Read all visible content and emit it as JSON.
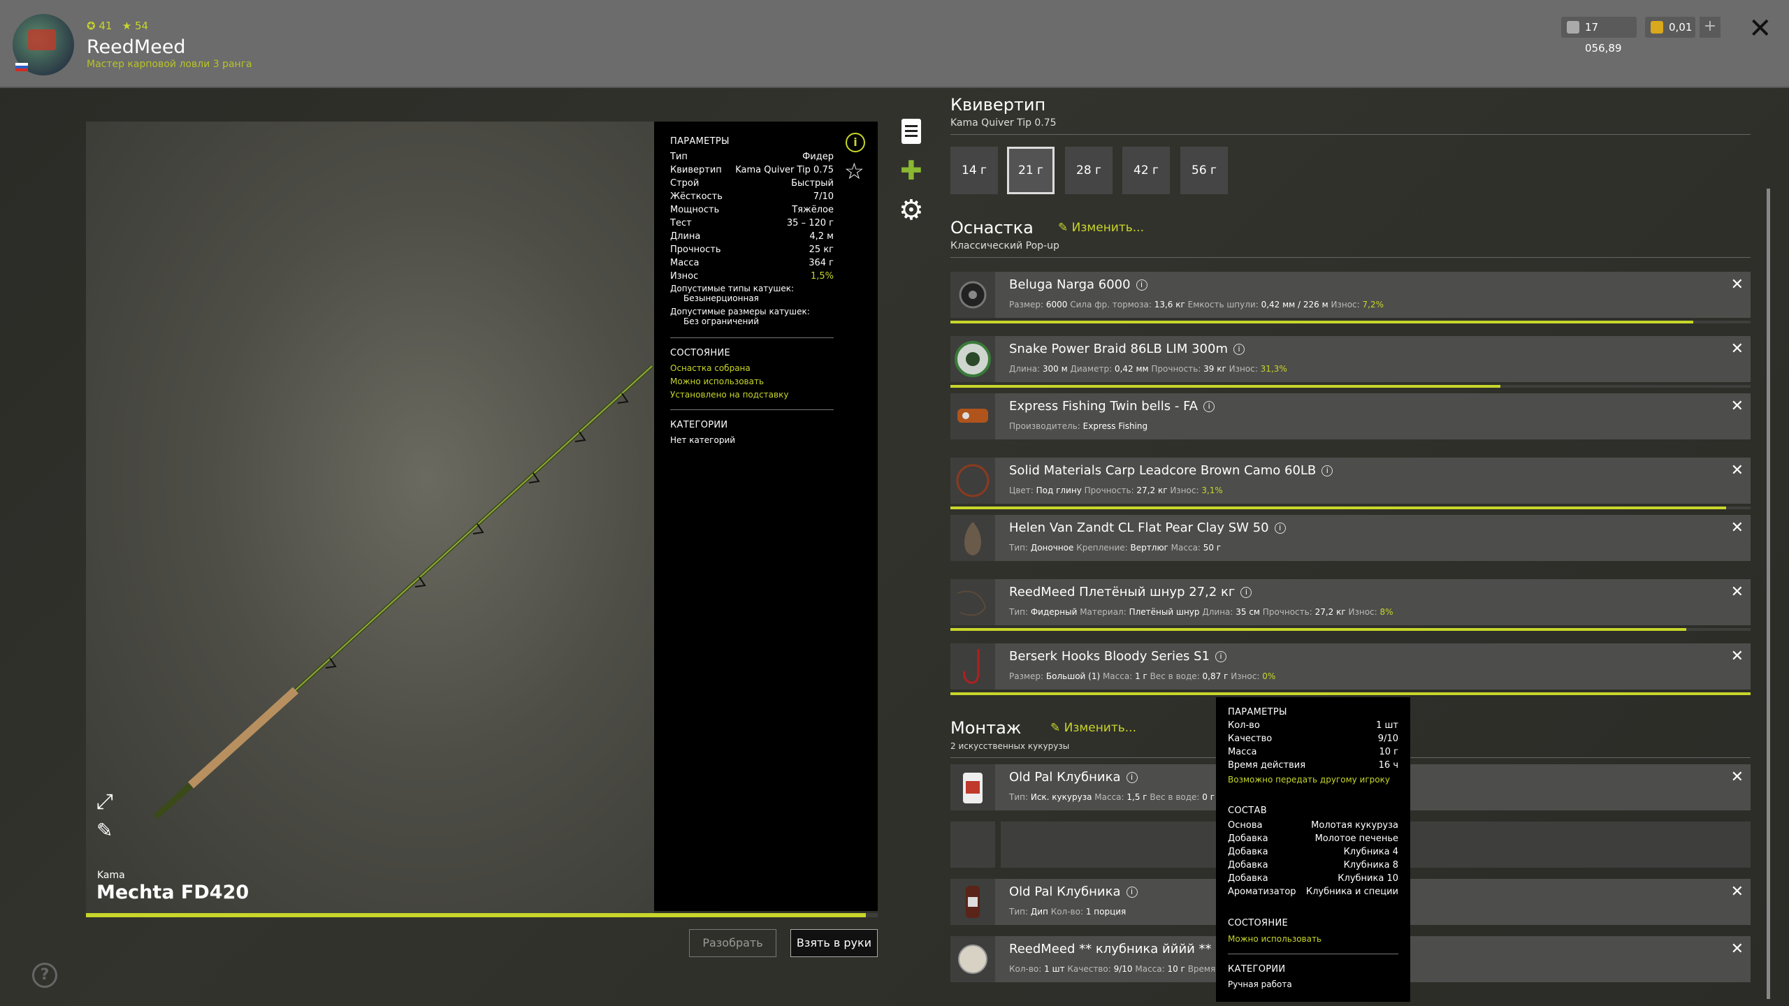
{
  "header": {
    "player_level": "41",
    "player_stars": "54",
    "username": "ReedMeed",
    "rank": "Мастер карповой ловли 3 ранга",
    "silver": "17 056,89",
    "gold": "0,01"
  },
  "rod": {
    "brand": "Kama",
    "name": "Mechta FD420",
    "btn_disassemble": "Разобрать",
    "btn_take": "Взять в руки"
  },
  "params": {
    "title": "ПАРАМЕТРЫ",
    "rows": [
      [
        "Тип",
        "Фидер"
      ],
      [
        "Квивертип",
        "Kama Quiver Tip 0.75"
      ],
      [
        "Строй",
        "Быстрый"
      ],
      [
        "Жёсткость",
        "7/10"
      ],
      [
        "Мощность",
        "Тяжёлое"
      ],
      [
        "Тест",
        "35 – 120 г"
      ],
      [
        "Длина",
        "4,2 м"
      ],
      [
        "Прочность",
        "25 кг"
      ],
      [
        "Масса",
        "364 г"
      ],
      [
        "Износ",
        "1,5%"
      ]
    ],
    "reel_types_label": "Допустимые типы катушек:",
    "reel_types_value": "Безынерционная",
    "reel_sizes_label": "Допустимые размеры катушек:",
    "reel_sizes_value": "Без ограничений",
    "state_title": "СОСТОЯНИЕ",
    "state": [
      "Оснастка собрана",
      "Можно использовать",
      "Установлено на подставку"
    ],
    "cat_title": "КАТЕГОРИИ",
    "cat_value": "Нет категорий"
  },
  "quivertip": {
    "title": "Квивертип",
    "subtitle": "Kama Quiver Tip 0.75",
    "weights": [
      "14 г",
      "21 г",
      "28 г",
      "42 г",
      "56 г"
    ],
    "selected": 1
  },
  "tackle": {
    "title": "Оснастка",
    "edit": "Изменить...",
    "subtitle": "Классический Pop-up",
    "items": [
      {
        "name": "Beluga Narga 6000",
        "info": [
          [
            "Размер: ",
            "6000"
          ],
          [
            " Сила фр. тормоза: ",
            "13,6 кг"
          ],
          [
            " Емкость шпули: ",
            "0,42 мм / 226 м"
          ],
          [
            " Износ: ",
            "7,2%"
          ]
        ],
        "wear": 0.928
      },
      {
        "name": "Snake Power Braid 86LB LIM 300m",
        "info": [
          [
            "Длина: ",
            "300 м"
          ],
          [
            " Диаметр: ",
            "0,42 мм"
          ],
          [
            " Прочность: ",
            "39 кг"
          ],
          [
            " Износ: ",
            "31,3%"
          ]
        ],
        "wear": 0.687
      },
      {
        "name": "Express Fishing Twin bells - FA",
        "info": [
          [
            "Производитель: ",
            "Express Fishing"
          ]
        ],
        "wear": null
      },
      {
        "name": "Solid Materials Carp Leadcore Brown Camo 60LB",
        "info": [
          [
            "Цвет: ",
            "Под глину"
          ],
          [
            " Прочность: ",
            "27,2 кг"
          ],
          [
            " Износ: ",
            "3,1%"
          ]
        ],
        "wear": 0.969
      },
      {
        "name": "Helen Van Zandt CL Flat Pear Clay SW 50",
        "info": [
          [
            "Тип: ",
            "Доночное"
          ],
          [
            " Крепление: ",
            "Вертлюг"
          ],
          [
            " Масса: ",
            "50 г"
          ]
        ],
        "wear": null
      },
      {
        "name": "ReedMeed Плетёный шнур 27,2 кг",
        "info": [
          [
            "Тип: ",
            "Фидерный"
          ],
          [
            " Материал: ",
            "Плетёный шнур"
          ],
          [
            " Длина: ",
            "35 см"
          ],
          [
            " Прочность: ",
            "27,2 кг"
          ],
          [
            " Износ: ",
            "8%"
          ]
        ],
        "wear": 0.92
      },
      {
        "name": "Berserk Hooks Bloody Series S1",
        "info": [
          [
            "Размер: ",
            "Большой (1)"
          ],
          [
            " Масса: ",
            "1 г"
          ],
          [
            " Вес в воде: ",
            "0,87 г"
          ],
          [
            " Износ: ",
            "0%"
          ]
        ],
        "wear": 1.0
      }
    ]
  },
  "rig": {
    "title": "Монтаж",
    "edit": "Изменить...",
    "subtitle": "2 искусственных кукурузы",
    "items": [
      {
        "name": "Old Pal Клубника",
        "info": [
          [
            "Тип: ",
            "Иск. кукуруза"
          ],
          [
            " Масса: ",
            "1,5 г"
          ],
          [
            " Вес в воде: ",
            "0 г"
          ]
        ]
      },
      {
        "name": "Old Pal Клубника",
        "info": [
          [
            "Тип: ",
            "Дип"
          ],
          [
            " Кол-во: ",
            "1 порция"
          ]
        ]
      },
      {
        "name": "ReedMeed ** клубника йййй **",
        "info": [
          [
            "Кол-во: ",
            "1 шт"
          ],
          [
            " Качество: ",
            "9/10"
          ],
          [
            " Масса: ",
            "10 г"
          ],
          [
            " Время д",
            ""
          ]
        ]
      }
    ]
  },
  "popup": {
    "params_title": "ПАРАМЕТРЫ",
    "rows": [
      [
        "Кол-во",
        "1 шт"
      ],
      [
        "Качество",
        "9/10"
      ],
      [
        "Масса",
        "10 г"
      ],
      [
        "Время действия",
        "16 ч"
      ]
    ],
    "transfer": "Возможно передать другому игроку",
    "comp_title": "СОСТАВ",
    "comp": [
      [
        "Основа",
        "Молотая кукуруза"
      ],
      [
        "Добавка",
        "Молотое печенье"
      ],
      [
        "Добавка",
        "Клубника 4"
      ],
      [
        "Добавка",
        "Клубника 8"
      ],
      [
        "Добавка",
        "Клубника 10"
      ],
      [
        "Ароматизатор",
        "Клубника и специи"
      ]
    ],
    "state_title": "СОСТОЯНИЕ",
    "state": "Можно использовать",
    "cat_title": "КАТЕГОРИИ",
    "cat": "Ручная работа"
  },
  "colors": {
    "accent": "#c7d62a",
    "panel": "#4d4d4b",
    "header": "#6c6c6c"
  }
}
